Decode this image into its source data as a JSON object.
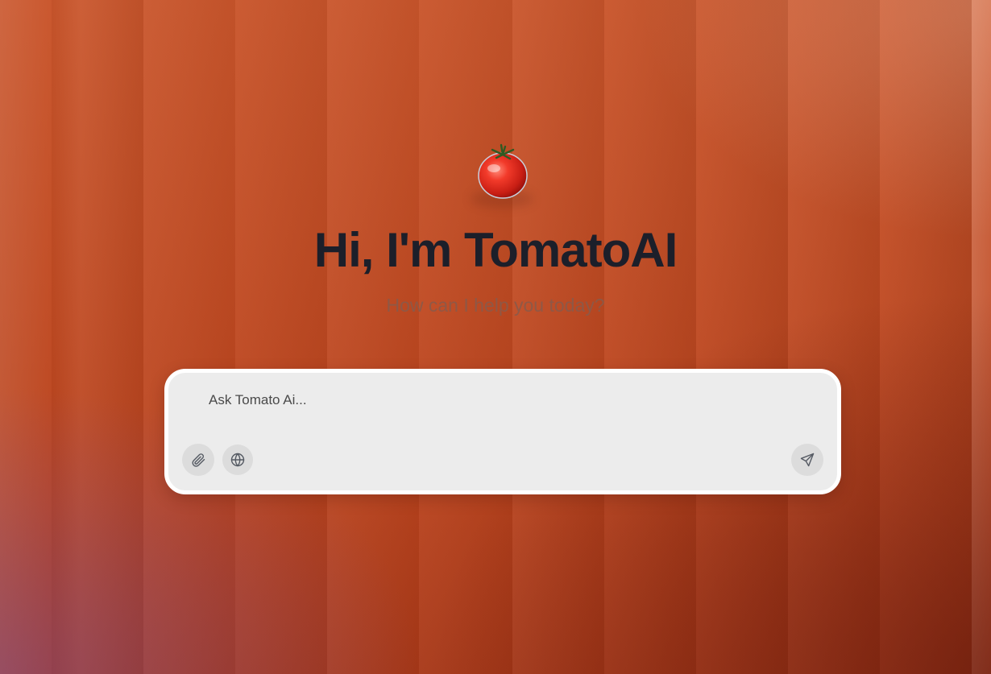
{
  "hero": {
    "logo_icon": "tomato-icon",
    "title": "Hi, I'm TomatoAI",
    "subtitle": "How can I help you today?"
  },
  "composer": {
    "placeholder": "Ask Tomato Ai...",
    "value": "",
    "attach_icon": "paperclip-icon",
    "web_icon": "globe-icon",
    "send_icon": "send-icon"
  },
  "colors": {
    "background": "#c24a22",
    "title": "#1c1f2a",
    "subtitle": "#8a5a4a",
    "composer_bg": "#ececec",
    "composer_border": "#ffffff"
  }
}
